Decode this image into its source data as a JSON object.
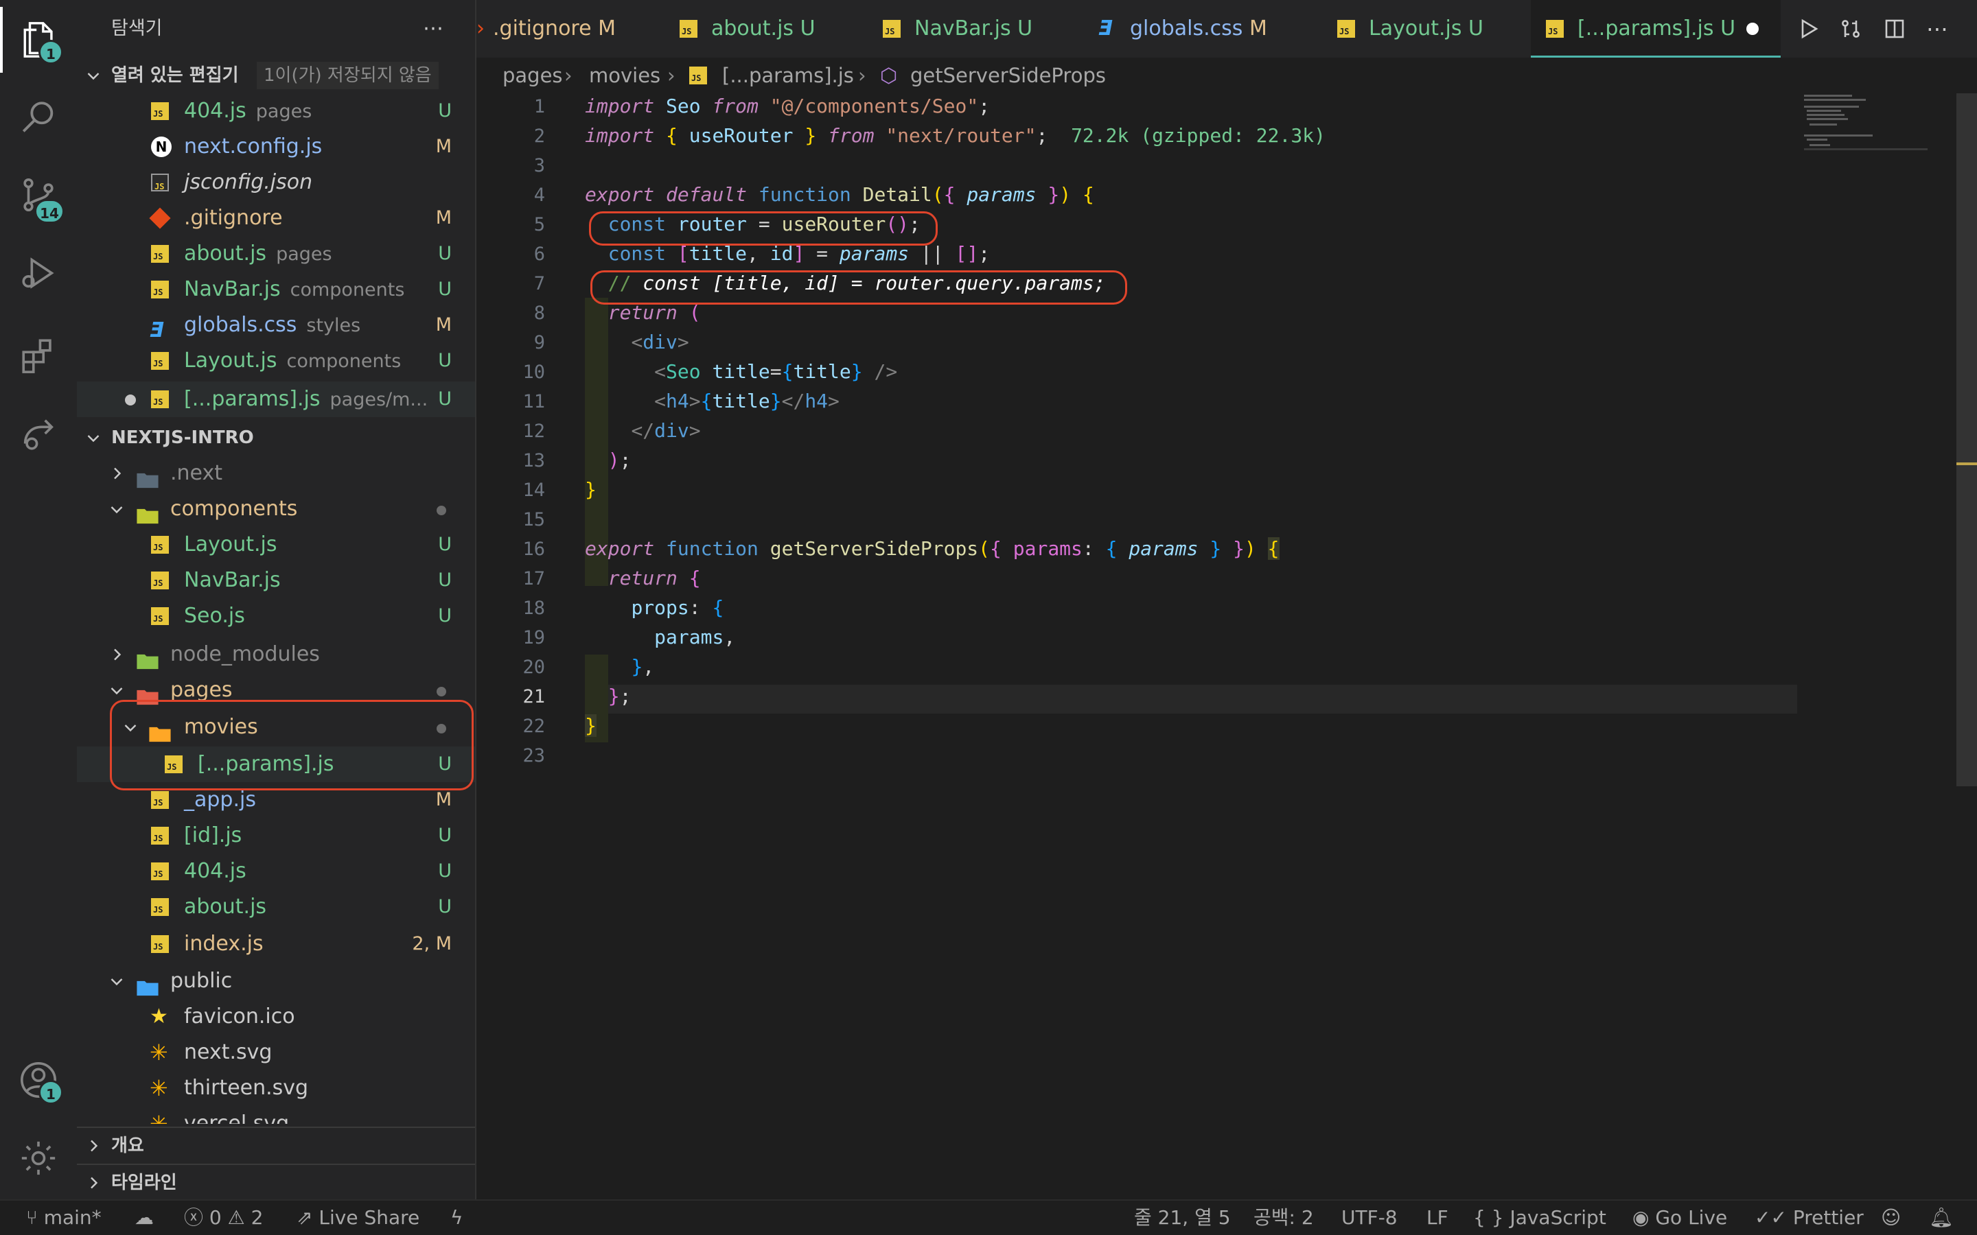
{
  "activity_bar": {
    "explorer_badge": "1",
    "source_control_badge": "14",
    "accounts_badge": "1"
  },
  "sidebar": {
    "title": "탐색기",
    "open_editors": {
      "title": "열려 있는 편집기",
      "note": "1이(가) 저장되지 않음",
      "items": [
        {
          "name": "404.js",
          "desc": "pages",
          "status": "U"
        },
        {
          "name": "next.config.js",
          "desc": "",
          "status": "M"
        },
        {
          "name": "jsconfig.json",
          "desc": "",
          "status": ""
        },
        {
          "name": ".gitignore",
          "desc": "",
          "status": "M"
        },
        {
          "name": "about.js",
          "desc": "pages",
          "status": "U"
        },
        {
          "name": "NavBar.js",
          "desc": "components",
          "status": "U"
        },
        {
          "name": "globals.css",
          "desc": "styles",
          "status": "M"
        },
        {
          "name": "Layout.js",
          "desc": "components",
          "status": "U"
        },
        {
          "name": "[...params].js",
          "desc": "pages/m...",
          "status": "U"
        }
      ]
    },
    "project": {
      "title": "NEXTJS-INTRO",
      "items": [
        {
          "name": ".next",
          "status": ""
        },
        {
          "name": "components",
          "status": ""
        },
        {
          "name": "Layout.js",
          "status": "U"
        },
        {
          "name": "NavBar.js",
          "status": "U"
        },
        {
          "name": "Seo.js",
          "status": "U"
        },
        {
          "name": "node_modules",
          "status": ""
        },
        {
          "name": "pages",
          "status": ""
        },
        {
          "name": "movies",
          "status": ""
        },
        {
          "name": "[...params].js",
          "status": "U"
        },
        {
          "name": "_app.js",
          "status": "M"
        },
        {
          "name": "[id].js",
          "status": "U"
        },
        {
          "name": "404.js",
          "status": "U"
        },
        {
          "name": "about.js",
          "status": "U"
        },
        {
          "name": "index.js",
          "status": "2, M"
        },
        {
          "name": "public",
          "status": ""
        },
        {
          "name": "favicon.ico",
          "status": ""
        },
        {
          "name": "next.svg",
          "status": ""
        },
        {
          "name": "thirteen.svg",
          "status": ""
        },
        {
          "name": "vercel.svg",
          "status": ""
        }
      ]
    },
    "outline_title": "개요",
    "timeline_title": "타임라인"
  },
  "tabs": [
    {
      "name": ".gitignore",
      "status": "M"
    },
    {
      "name": "about.js",
      "status": "U"
    },
    {
      "name": "NavBar.js",
      "status": "U"
    },
    {
      "name": "globals.css",
      "status": "M"
    },
    {
      "name": "Layout.js",
      "status": "U"
    },
    {
      "name": "[...params].js",
      "status": "U"
    }
  ],
  "breadcrumb": [
    "pages",
    "movies",
    "[...params].js",
    "getServerSideProps"
  ],
  "editor": {
    "line_numbers": [
      "1",
      "2",
      "3",
      "4",
      "5",
      "6",
      "7",
      "8",
      "9",
      "10",
      "11",
      "12",
      "13",
      "14",
      "15",
      "16",
      "17",
      "18",
      "19",
      "20",
      "21",
      "22",
      "23"
    ],
    "current_line": "21",
    "import_cost": "72.2k (gzipped: 22.3k)"
  },
  "statusbar": {
    "branch": "main*",
    "errors": "0",
    "warnings": "2",
    "live_share": "Live Share",
    "position": "줄 21, 열 5",
    "spaces": "공백: 2",
    "encoding": "UTF-8",
    "eol": "LF",
    "language": "JavaScript",
    "go_live": "Go Live",
    "prettier": "Prettier"
  },
  "colors": {
    "modified": "#e2c08d",
    "untracked": "#73c991",
    "highlight_box": "#e0442b",
    "badge": "#4db6ac"
  }
}
